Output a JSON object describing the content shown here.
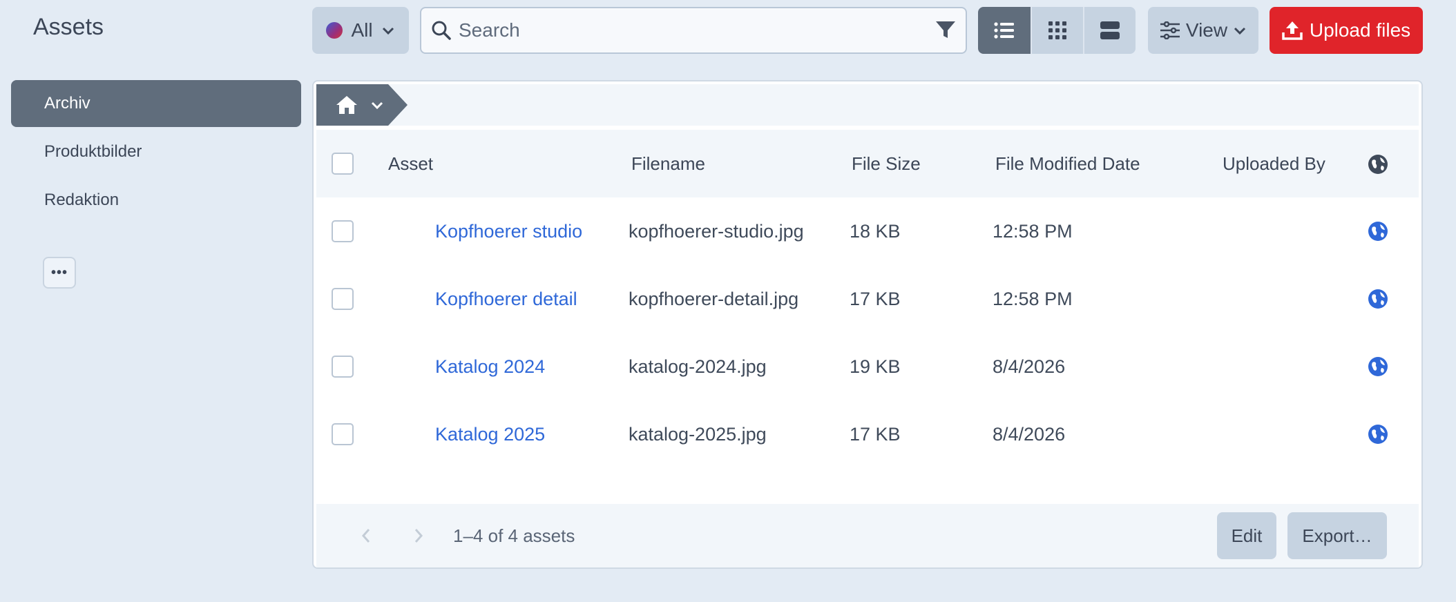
{
  "page": {
    "title": "Assets"
  },
  "toolbar": {
    "site_filter_label": "All",
    "search_placeholder": "Search",
    "view_label": "View",
    "upload_label": "Upload files"
  },
  "sidebar": {
    "items": [
      {
        "label": "Archiv",
        "active": true
      },
      {
        "label": "Produktbilder",
        "active": false
      },
      {
        "label": "Redaktion",
        "active": false
      }
    ],
    "more_label": "•••"
  },
  "table": {
    "columns": [
      "Asset",
      "Filename",
      "File Size",
      "File Modified Date",
      "Uploaded By"
    ],
    "rows": [
      {
        "asset": "Kopfhoerer studio",
        "filename": "kopfhoerer-studio.jpg",
        "size": "18 KB",
        "modified": "12:58 PM"
      },
      {
        "asset": "Kopfhoerer detail",
        "filename": "kopfhoerer-detail.jpg",
        "size": "17 KB",
        "modified": "12:58 PM"
      },
      {
        "asset": "Katalog 2024",
        "filename": "katalog-2024.jpg",
        "size": "19 KB",
        "modified": "8/4/2026"
      },
      {
        "asset": "Katalog 2025",
        "filename": "katalog-2025.jpg",
        "size": "17 KB",
        "modified": "8/4/2026"
      }
    ]
  },
  "footer": {
    "count_text": "1–4 of 4 assets",
    "edit_label": "Edit",
    "export_label": "Export…"
  },
  "colors": {
    "accent": "#2f68d8",
    "upload": "#e0242a",
    "dark": "#606d7c"
  }
}
